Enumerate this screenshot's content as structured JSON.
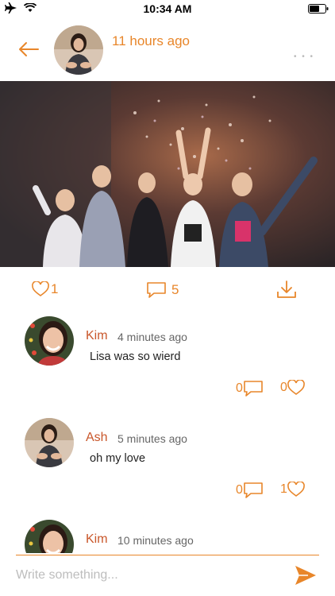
{
  "status_bar": {
    "time": "10:34 AM"
  },
  "post": {
    "time_ago": "11 hours ago",
    "likes": "1",
    "comments": "5"
  },
  "comments": [
    {
      "name": "Kim",
      "time": "4 minutes ago",
      "text": "Lisa was so wierd",
      "replies": "0",
      "likes": "0"
    },
    {
      "name": "Ash",
      "time": "5 minutes ago",
      "text": "oh my love",
      "replies": "0",
      "likes": "1"
    },
    {
      "name": "Kim",
      "time": "10 minutes ago"
    }
  ],
  "composer": {
    "placeholder": "Write something..."
  },
  "colors": {
    "accent": "#e8862a",
    "name": "#c9572b"
  }
}
